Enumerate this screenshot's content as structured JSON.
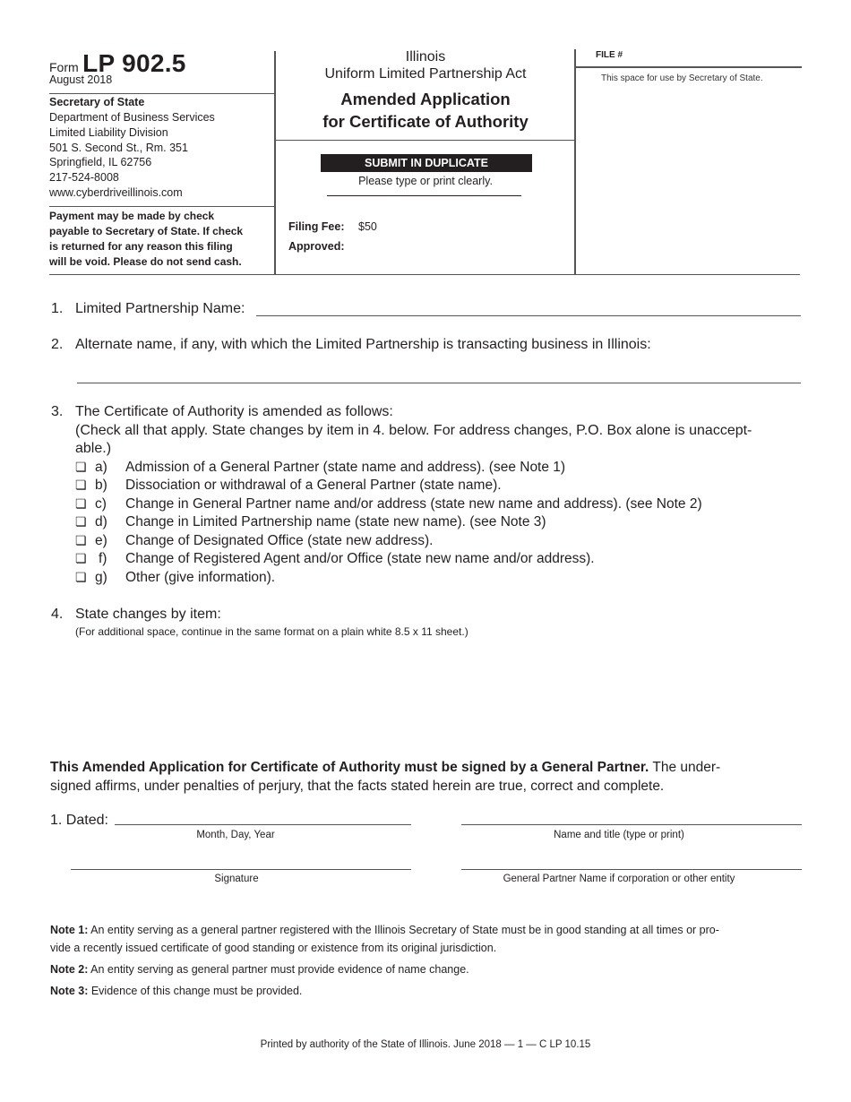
{
  "header": {
    "form_word": "Form",
    "form_number": "LP 902.5",
    "form_date": "August 2018",
    "agency": {
      "name": "Secretary of State",
      "lines": [
        "Department of Business Services",
        "Limited Liability Division",
        "501 S. Second St., Rm. 351",
        "Springfield, IL  62756",
        "217-524-8008",
        "www.cyberdriveillinois.com"
      ]
    },
    "payment_notice": [
      "Payment may be made by check",
      "payable to Secretary of State. If check",
      "is returned for any reason this filing",
      "will be void. Please do not send cash."
    ],
    "state": "Illinois",
    "act": "Uniform Limited Partnership Act",
    "title_line1": "Amended Application",
    "title_line2": "for Certificate of Authority",
    "submit_banner": "SUBMIT IN DUPLICATE",
    "instruction": "Please type or print clearly.",
    "filing_fee_label": "Filing Fee:",
    "filing_fee_value": "$50",
    "approved_label": "Approved:",
    "file_label": "FILE #",
    "office_use_note": "This space for use by Secretary of State."
  },
  "items": {
    "item1": {
      "number": "1.",
      "label": "Limited Partnership Name:",
      "value": ""
    },
    "item2": {
      "number": "2.",
      "label": "Alternate name, if any, with which the Limited Partnership is transacting business in Illinois:",
      "value": ""
    },
    "item3": {
      "number": "3.",
      "label": "The Certificate of Authority is amended as follows:",
      "instruction_line1": "(Check all that apply. State changes by item in 4. below. For address changes, P.O. Box alone is unaccept-",
      "instruction_line2": "able.)",
      "checkbox_glyph": "❏",
      "options": [
        {
          "letter": "a)",
          "text": "Admission of a General Partner (state name and address). (see Note 1)",
          "checked": false
        },
        {
          "letter": "b)",
          "text": "Dissociation or withdrawal of a General Partner (state name).",
          "checked": false
        },
        {
          "letter": "c)",
          "text": "Change in General Partner name and/or address (state new name and address). (see Note 2)",
          "checked": false
        },
        {
          "letter": "d)",
          "text": "Change in Limited Partnership name (state new name). (see Note 3)",
          "checked": false
        },
        {
          "letter": "e)",
          "text": "Change of Designated Office (state new address).",
          "checked": false
        },
        {
          "letter": "f)",
          "text": "Change of Registered Agent and/or Office (state new name and/or address).",
          "checked": false
        },
        {
          "letter": "g)",
          "text": "Other (give information).",
          "checked": false
        }
      ]
    },
    "item4": {
      "number": "4.",
      "label": "State changes by item:",
      "note": "(For additional space, continue in the same format on a plain white 8.5 x 11 sheet.)",
      "value": ""
    }
  },
  "attestation": {
    "bold": "This Amended Application for Certificate of Authority must be signed by a General Partner.",
    "rest_line1": " The under-",
    "line2": "signed affirms, under penalties of perjury, that the facts stated herein are true, correct and complete."
  },
  "signature": {
    "dated_label": "1. Dated:",
    "dated_caption": "Month, Day, Year",
    "name_title_caption": "Name and title (type or print)",
    "signature_caption": "Signature",
    "gp_name_caption": "General Partner Name if corporation or other entity"
  },
  "notes": [
    {
      "label": "Note 1:",
      "line1": " An entity serving as a general partner registered with the Illinois Secretary of State must be in good standing at all times or pro-",
      "line2": "vide a recently issued certificate of good standing or existence from its original jurisdiction."
    },
    {
      "label": "Note 2:",
      "line1": " An entity serving as general partner must provide evidence of name change."
    },
    {
      "label": "Note 3:",
      "line1": " Evidence of this change must be provided."
    }
  ],
  "footer": "Printed by authority of the State of Illinois. June 2018 — 1 — C LP 10.15"
}
